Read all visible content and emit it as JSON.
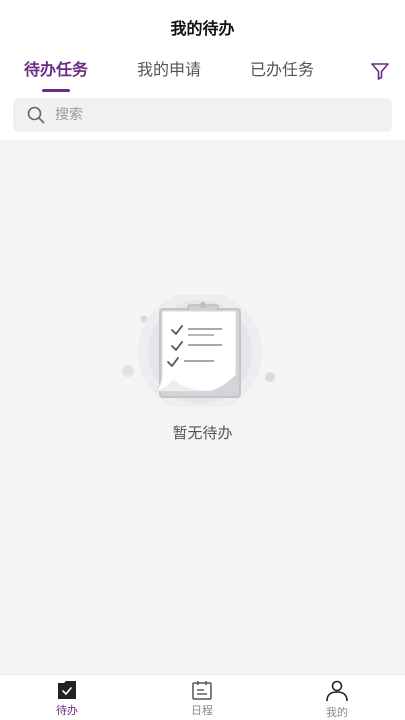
{
  "header": {
    "title": "我的待办"
  },
  "tabs": [
    {
      "label": "待办任务",
      "active": true
    },
    {
      "label": "我的申请",
      "active": false
    },
    {
      "label": "已办任务",
      "active": false
    }
  ],
  "filter": {
    "icon": "filter-icon"
  },
  "search": {
    "placeholder": "搜索",
    "value": "",
    "icon": "search-icon"
  },
  "empty_state": {
    "text": "暂无待办",
    "icon": "clipboard-checklist-illustration"
  },
  "bottom_nav": [
    {
      "label": "待办",
      "icon": "todo-check-icon",
      "active": true
    },
    {
      "label": "日程",
      "icon": "calendar-icon",
      "active": false
    },
    {
      "label": "我的",
      "icon": "user-icon",
      "active": false
    }
  ],
  "colors": {
    "accent": "#6b2c86",
    "background": "#f5f5f5",
    "text": "#111111",
    "muted": "#888888"
  }
}
